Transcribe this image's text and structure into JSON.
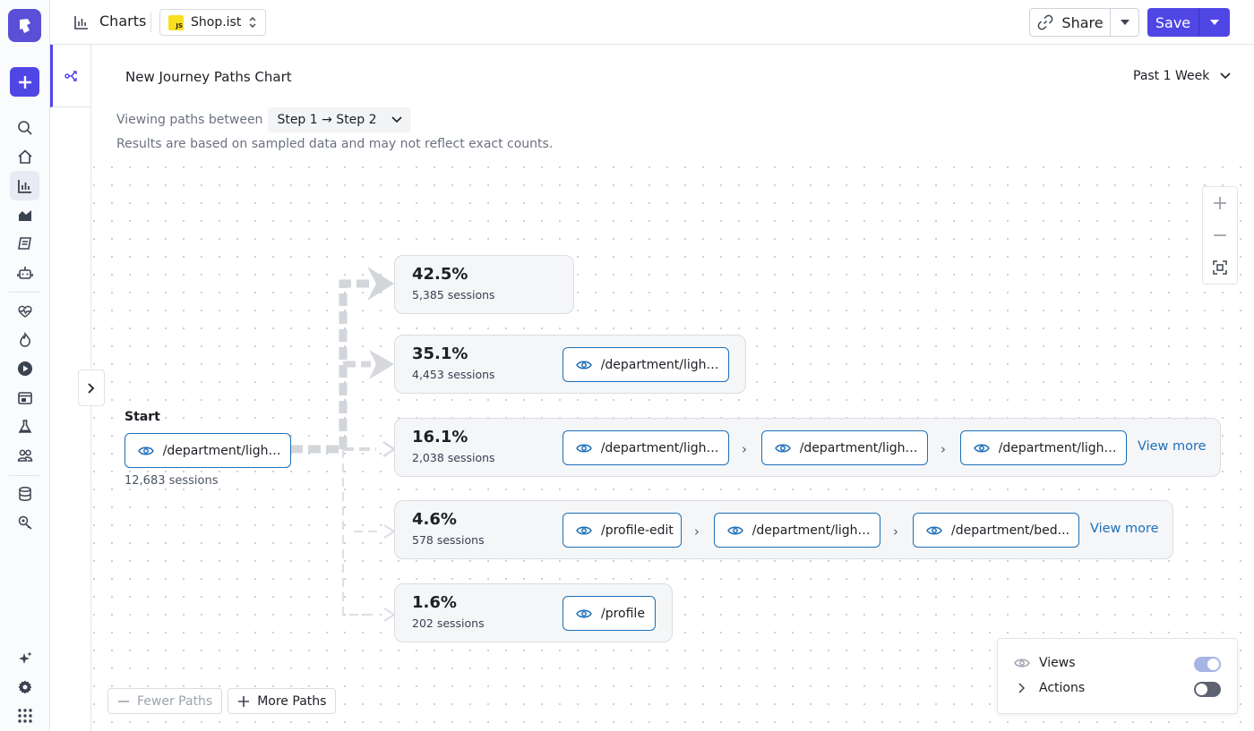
{
  "app": {
    "section": "Charts",
    "project": "Shop.ist",
    "project_badge": "JS"
  },
  "toolbar": {
    "share_label": "Share",
    "save_label": "Save"
  },
  "chart": {
    "title": "New Journey Paths Chart",
    "time_range": "Past 1 Week",
    "viewing_label": "Viewing paths between",
    "step_range": "Step 1 → Step 2",
    "note": "Results are based on sampled data and may not reflect exact counts."
  },
  "start": {
    "label": "Start",
    "page": "/department/light...",
    "sessions": "12,683 sessions"
  },
  "paths": [
    {
      "pct": "42.5%",
      "sessions": "5,385 sessions",
      "pages": [],
      "more": ""
    },
    {
      "pct": "35.1%",
      "sessions": "4,453 sessions",
      "pages": [
        "/department/light..."
      ],
      "more": ""
    },
    {
      "pct": "16.1%",
      "sessions": "2,038 sessions",
      "pages": [
        "/department/light...",
        "/department/light...",
        "/department/light..."
      ],
      "more": "View more"
    },
    {
      "pct": "4.6%",
      "sessions": "578 sessions",
      "pages": [
        "/profile-edit",
        "/department/light...",
        "/department/bed..."
      ],
      "more": "View more"
    },
    {
      "pct": "1.6%",
      "sessions": "202 sessions",
      "pages": [
        "/profile"
      ],
      "more": ""
    }
  ],
  "path_controls": {
    "fewer": "Fewer Paths",
    "more": "More Paths"
  },
  "legend": {
    "views": "Views",
    "views_on": true,
    "actions": "Actions",
    "actions_on": false
  },
  "colors": {
    "brand": "#5046e5",
    "link": "#1d6fb8"
  },
  "icons": [
    "logo-icon",
    "plus-icon",
    "search-icon",
    "home-icon",
    "bar-chart-icon",
    "area-chart-icon",
    "notebook-icon",
    "robot-icon",
    "heartbeat-icon",
    "flame-icon",
    "play-icon",
    "window-icon",
    "flask-icon",
    "users-icon",
    "database-icon",
    "settings-search-icon",
    "sparkle-icon",
    "gear-icon",
    "grid-icon",
    "link-icon",
    "eye-icon",
    "chevron-down-icon",
    "zoom-in-icon",
    "zoom-out-icon",
    "fit-icon"
  ]
}
